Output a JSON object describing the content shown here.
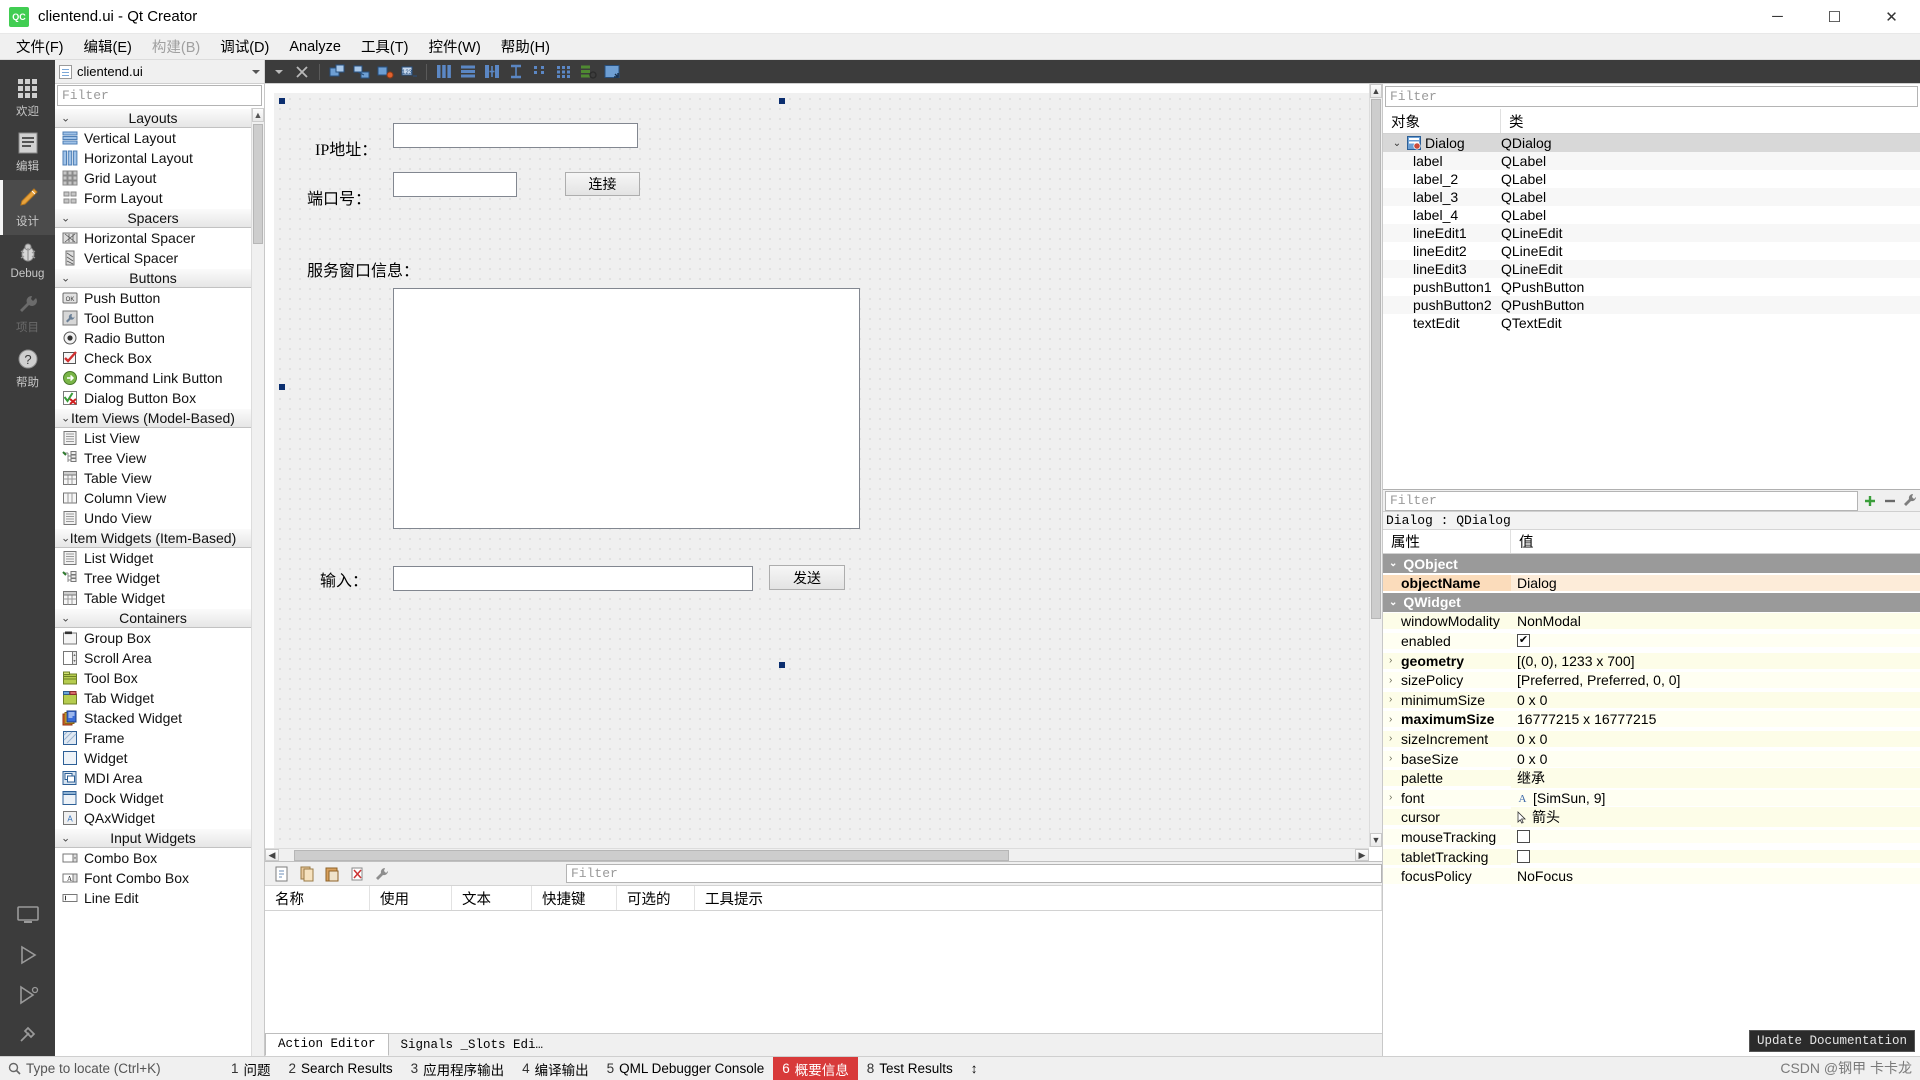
{
  "titlebar": {
    "icon": "qt-creator-logo-icon",
    "title": "clientend.ui - Qt Creator",
    "minimize": "─",
    "maximize": "☐",
    "close": "✕"
  },
  "menubar": {
    "items": [
      {
        "label": "文件(F)",
        "disabled": false
      },
      {
        "label": "编辑(E)",
        "disabled": false
      },
      {
        "label": "构建(B)",
        "disabled": true
      },
      {
        "label": "调试(D)",
        "disabled": false
      },
      {
        "label": "Analyze",
        "disabled": false
      },
      {
        "label": "工具(T)",
        "disabled": false
      },
      {
        "label": "控件(W)",
        "disabled": false
      },
      {
        "label": "帮助(H)",
        "disabled": false
      }
    ]
  },
  "modebar": {
    "items": [
      {
        "label": "欢迎",
        "icon": "grid-squares-icon",
        "state": "normal"
      },
      {
        "label": "编辑",
        "icon": "document-lines-icon",
        "state": "normal"
      },
      {
        "label": "设计",
        "icon": "pencil-icon",
        "state": "active"
      },
      {
        "label": "Debug",
        "icon": "bug-icon",
        "state": "normal"
      },
      {
        "label": "项目",
        "icon": "wrench-icon",
        "state": "disabled"
      },
      {
        "label": "帮助",
        "icon": "question-circle-icon",
        "state": "normal"
      }
    ],
    "bottom_icons": [
      "monitor-icon",
      "run-triangle-icon",
      "debug-run-icon",
      "hammer-icon"
    ]
  },
  "file_selector": {
    "filename": "clientend.ui",
    "icon": "ui-file-icon",
    "dropdown": "chevron-down-icon"
  },
  "designer_toolbar": {
    "buttons": [
      "close-form-icon",
      "edit-widgets-icon",
      "edit-signals-icon",
      "edit-buddies-icon",
      "edit-tab-order-icon",
      "layout-horizontal-icon",
      "layout-vertical-icon",
      "layout-splitter-h-icon",
      "layout-splitter-v-icon",
      "layout-form-icon",
      "layout-grid-icon",
      "break-layout-icon",
      "adjust-size-icon"
    ]
  },
  "widget_box": {
    "filter_placeholder": "Filter",
    "groups": [
      {
        "name": "Layouts",
        "items": [
          {
            "label": "Vertical Layout",
            "icon": "vertical-layout-icon"
          },
          {
            "label": "Horizontal Layout",
            "icon": "horizontal-layout-icon"
          },
          {
            "label": "Grid Layout",
            "icon": "grid-layout-icon"
          },
          {
            "label": "Form Layout",
            "icon": "form-layout-icon"
          }
        ]
      },
      {
        "name": "Spacers",
        "items": [
          {
            "label": "Horizontal Spacer",
            "icon": "horizontal-spacer-icon"
          },
          {
            "label": "Vertical Spacer",
            "icon": "vertical-spacer-icon"
          }
        ]
      },
      {
        "name": "Buttons",
        "items": [
          {
            "label": "Push Button",
            "icon": "push-button-icon"
          },
          {
            "label": "Tool Button",
            "icon": "tool-button-icon"
          },
          {
            "label": "Radio Button",
            "icon": "radio-button-icon"
          },
          {
            "label": "Check Box",
            "icon": "check-box-icon"
          },
          {
            "label": "Command Link Button",
            "icon": "command-link-button-icon"
          },
          {
            "label": "Dialog Button Box",
            "icon": "dialog-button-box-icon"
          }
        ]
      },
      {
        "name": "Item Views (Model-Based)",
        "items": [
          {
            "label": "List View",
            "icon": "list-view-icon"
          },
          {
            "label": "Tree View",
            "icon": "tree-view-icon"
          },
          {
            "label": "Table View",
            "icon": "table-view-icon"
          },
          {
            "label": "Column View",
            "icon": "column-view-icon"
          },
          {
            "label": "Undo View",
            "icon": "undo-view-icon"
          }
        ]
      },
      {
        "name": "Item Widgets (Item-Based)",
        "items": [
          {
            "label": "List Widget",
            "icon": "list-widget-icon"
          },
          {
            "label": "Tree Widget",
            "icon": "tree-widget-icon"
          },
          {
            "label": "Table Widget",
            "icon": "table-widget-icon"
          }
        ]
      },
      {
        "name": "Containers",
        "items": [
          {
            "label": "Group Box",
            "icon": "group-box-icon"
          },
          {
            "label": "Scroll Area",
            "icon": "scroll-area-icon"
          },
          {
            "label": "Tool Box",
            "icon": "tool-box-icon"
          },
          {
            "label": "Tab Widget",
            "icon": "tab-widget-icon"
          },
          {
            "label": "Stacked Widget",
            "icon": "stacked-widget-icon"
          },
          {
            "label": "Frame",
            "icon": "frame-icon"
          },
          {
            "label": "Widget",
            "icon": "widget-icon"
          },
          {
            "label": "MDI Area",
            "icon": "mdi-area-icon"
          },
          {
            "label": "Dock Widget",
            "icon": "dock-widget-icon"
          },
          {
            "label": "QAxWidget",
            "icon": "qax-widget-icon"
          }
        ]
      },
      {
        "name": "Input Widgets",
        "items": [
          {
            "label": "Combo Box",
            "icon": "combo-box-icon"
          },
          {
            "label": "Font Combo Box",
            "icon": "font-combo-box-icon"
          },
          {
            "label": "Line Edit",
            "icon": "line-edit-icon"
          }
        ]
      }
    ]
  },
  "form": {
    "labels": {
      "ip": "IP地址：",
      "port": "端口号：",
      "server_info": "服务窗口信息：",
      "input": "输入："
    },
    "buttons": {
      "connect": "连接",
      "send": "发送"
    },
    "inputs": {
      "ip_value": "",
      "port_value": "",
      "input_value": "",
      "textedit_value": ""
    }
  },
  "object_inspector": {
    "filter_placeholder": "Filter",
    "columns": [
      "对象",
      "类"
    ],
    "rows": [
      {
        "object": "Dialog",
        "class": "QDialog",
        "level": 0,
        "expander": "⌄",
        "icon": "dialog-icon",
        "selected": true
      },
      {
        "object": "label",
        "class": "QLabel",
        "level": 1,
        "expander": "",
        "icon": "",
        "selected": false
      },
      {
        "object": "label_2",
        "class": "QLabel",
        "level": 1,
        "expander": "",
        "icon": "",
        "selected": false
      },
      {
        "object": "label_3",
        "class": "QLabel",
        "level": 1,
        "expander": "",
        "icon": "",
        "selected": false
      },
      {
        "object": "label_4",
        "class": "QLabel",
        "level": 1,
        "expander": "",
        "icon": "",
        "selected": false
      },
      {
        "object": "lineEdit1",
        "class": "QLineEdit",
        "level": 1,
        "expander": "",
        "icon": "",
        "selected": false
      },
      {
        "object": "lineEdit2",
        "class": "QLineEdit",
        "level": 1,
        "expander": "",
        "icon": "",
        "selected": false
      },
      {
        "object": "lineEdit3",
        "class": "QLineEdit",
        "level": 1,
        "expander": "",
        "icon": "",
        "selected": false
      },
      {
        "object": "pushButton1",
        "class": "QPushButton",
        "level": 1,
        "expander": "",
        "icon": "",
        "selected": false
      },
      {
        "object": "pushButton2",
        "class": "QPushButton",
        "level": 1,
        "expander": "",
        "icon": "",
        "selected": false
      },
      {
        "object": "textEdit",
        "class": "QTextEdit",
        "level": 1,
        "expander": "",
        "icon": "",
        "selected": false
      }
    ]
  },
  "property_editor": {
    "filter_placeholder": "Filter",
    "add_icon": "plus-icon",
    "remove_icon": "minus-icon",
    "config_icon": "wrench-icon",
    "object_header": "Dialog : QDialog",
    "columns": [
      "属性",
      "值"
    ],
    "groups": [
      {
        "name": "QObject",
        "rows": [
          {
            "name": "objectName",
            "value": "Dialog",
            "bold": true,
            "expander": "",
            "tone": "orange"
          }
        ]
      },
      {
        "name": "QWidget",
        "rows": [
          {
            "name": "windowModality",
            "value": "NonModal",
            "bold": false,
            "expander": "",
            "tone": "y0"
          },
          {
            "name": "enabled",
            "value": "",
            "checkbox": true,
            "checked": true,
            "bold": false,
            "expander": "",
            "tone": "y1"
          },
          {
            "name": "geometry",
            "value": "[(0, 0), 1233 x 700]",
            "bold": true,
            "expander": "›",
            "tone": "y0"
          },
          {
            "name": "sizePolicy",
            "value": "[Preferred, Preferred, 0, 0]",
            "bold": false,
            "expander": "›",
            "tone": "y1"
          },
          {
            "name": "minimumSize",
            "value": "0 x 0",
            "bold": false,
            "expander": "›",
            "tone": "y0"
          },
          {
            "name": "maximumSize",
            "value": "16777215 x 16777215",
            "bold": true,
            "expander": "›",
            "tone": "y1"
          },
          {
            "name": "sizeIncrement",
            "value": "0 x 0",
            "bold": false,
            "expander": "›",
            "tone": "y0"
          },
          {
            "name": "baseSize",
            "value": "0 x 0",
            "bold": false,
            "expander": "›",
            "tone": "y1"
          },
          {
            "name": "palette",
            "value": "继承",
            "bold": false,
            "expander": "",
            "tone": "y0"
          },
          {
            "name": "font",
            "value": "[SimSun, 9]",
            "bold": false,
            "expander": "›",
            "tone": "y1",
            "prefix_icon": "font-A-icon"
          },
          {
            "name": "cursor",
            "value": "箭头",
            "bold": false,
            "expander": "",
            "tone": "y0",
            "prefix_icon": "cursor-arrow-icon"
          },
          {
            "name": "mouseTracking",
            "value": "",
            "checkbox": true,
            "checked": false,
            "bold": false,
            "expander": "",
            "tone": "y1"
          },
          {
            "name": "tabletTracking",
            "value": "",
            "checkbox": true,
            "checked": false,
            "bold": false,
            "expander": "",
            "tone": "y0"
          },
          {
            "name": "focusPolicy",
            "value": "NoFocus",
            "bold": false,
            "expander": "",
            "tone": "y1"
          }
        ]
      }
    ]
  },
  "action_editor": {
    "toolbar_icons": [
      "new-action-icon",
      "copy-icon",
      "paste-icon",
      "delete-icon",
      "configure-icon"
    ],
    "filter_placeholder": "Filter",
    "columns": [
      "名称",
      "使用",
      "文本",
      "快捷键",
      "可选的",
      "工具提示"
    ],
    "rows": [],
    "tabs": [
      {
        "label": "Action Editor",
        "active": true
      },
      {
        "label": "Signals _Slots Edi…",
        "active": false
      }
    ]
  },
  "statusbar": {
    "search_placeholder": "Type to locate (Ctrl+K)",
    "search_icon": "magnifier-icon",
    "items": [
      {
        "num": "1",
        "label": "问题",
        "highlight": false
      },
      {
        "num": "2",
        "label": "Search Results",
        "highlight": false
      },
      {
        "num": "3",
        "label": "应用程序输出",
        "highlight": false
      },
      {
        "num": "4",
        "label": "编译输出",
        "highlight": false
      },
      {
        "num": "5",
        "label": "QML Debugger Console",
        "highlight": false
      },
      {
        "num": "6",
        "label": "概要信息",
        "highlight": true
      },
      {
        "num": "8",
        "label": "Test Results",
        "highlight": false
      }
    ],
    "updown_icon": "up-down-arrows-icon"
  },
  "tooltip": {
    "text": "Update Documentation"
  },
  "watermark": {
    "text": "CSDN @钢甲 卡卡龙"
  },
  "colors": {
    "accent_green": "#41cd52",
    "mode_bg": "#3c3c3c",
    "mode_active": "#4b4b4b",
    "status_highlight": "#d83a3a",
    "property_group": "#9a9a9a",
    "selection": "#d8d8d8"
  }
}
